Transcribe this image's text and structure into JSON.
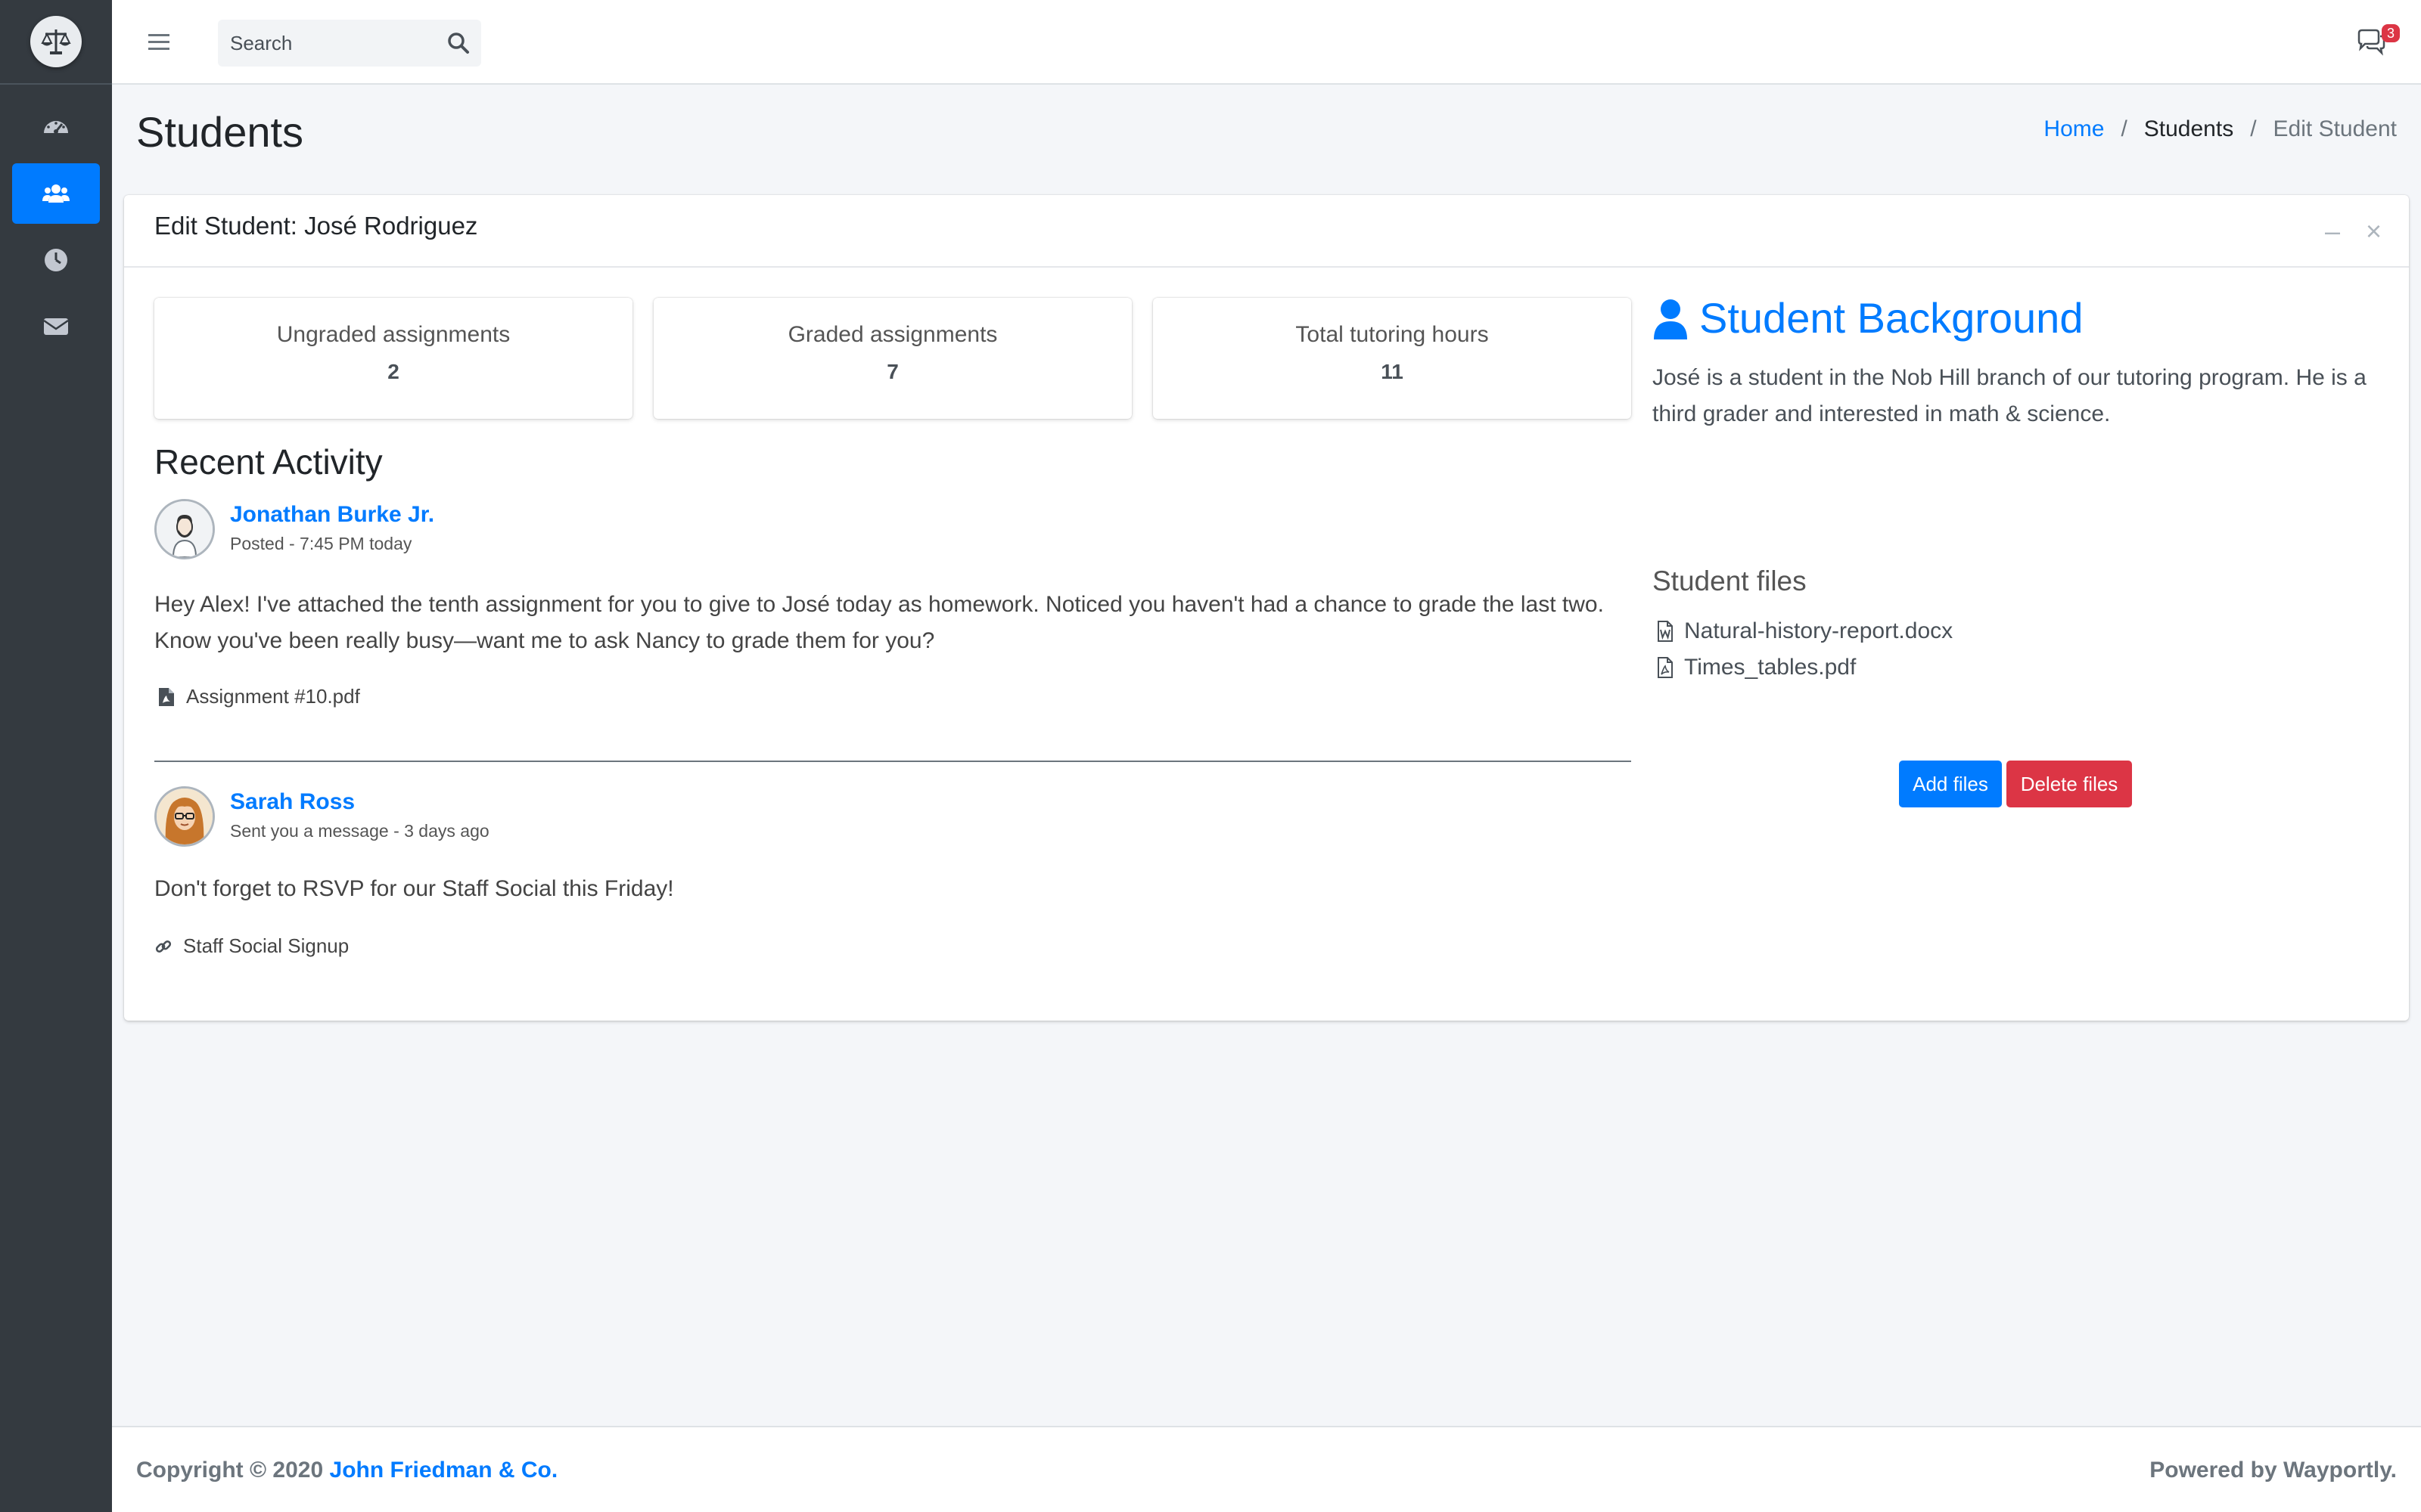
{
  "sidebar": {
    "logo_icon": "scales-of-justice-icon",
    "items": [
      {
        "icon": "dashboard-gauge-icon",
        "active": false
      },
      {
        "icon": "users-icon",
        "active": true
      },
      {
        "icon": "clock-icon",
        "active": false
      },
      {
        "icon": "envelope-icon",
        "active": false
      }
    ]
  },
  "topbar": {
    "search_placeholder": "Search",
    "notifications_count": "3"
  },
  "header": {
    "title": "Students",
    "breadcrumb": [
      "Home",
      "Students",
      "Edit Student"
    ],
    "breadcrumb_sep": "/"
  },
  "card": {
    "title": "Edit Student: José Rodriguez",
    "tools": {
      "minimize": "–",
      "close": "×"
    },
    "stats": [
      {
        "label": "Ungraded assignments",
        "value": "2"
      },
      {
        "label": "Graded assignments",
        "value": "7"
      },
      {
        "label": "Total tutoring hours",
        "value": "11"
      }
    ],
    "recent_title": "Recent Activity",
    "posts": [
      {
        "author": "Jonathan Burke Jr.",
        "meta": "Posted - 7:45 PM today",
        "text_line1": "Hey Alex! I've attached the tenth assignment for you to give to José today as homework. Noticed you haven't had a chance to grade the last two.",
        "text_line2": "Know you've been really busy—want me to ask Nancy to grade them for you?",
        "attachment": "Assignment #10.pdf"
      },
      {
        "author": "Sarah Ross",
        "meta": "Sent you a message - 3 days ago",
        "text_line1": "Don't forget to RSVP for our Staff Social this Friday!",
        "attachment": "Staff Social Signup"
      }
    ],
    "background": {
      "title": "Student Background",
      "text": "José is a student in the Nob Hill branch of our tutoring program. He is a third grader and interested in math & science."
    },
    "files": {
      "title": "Student files",
      "items": [
        "Natural-history-report.docx",
        "Times_tables.pdf"
      ],
      "add_label": "Add files",
      "delete_label": "Delete files"
    }
  },
  "footer": {
    "copyright_prefix": "Copyright © 2020",
    "company": "John Friedman & Co.",
    "powered": "Powered by Wayportly."
  },
  "colors": {
    "accent": "#007bff",
    "danger": "#dc3545",
    "sidebar": "#343a40"
  }
}
